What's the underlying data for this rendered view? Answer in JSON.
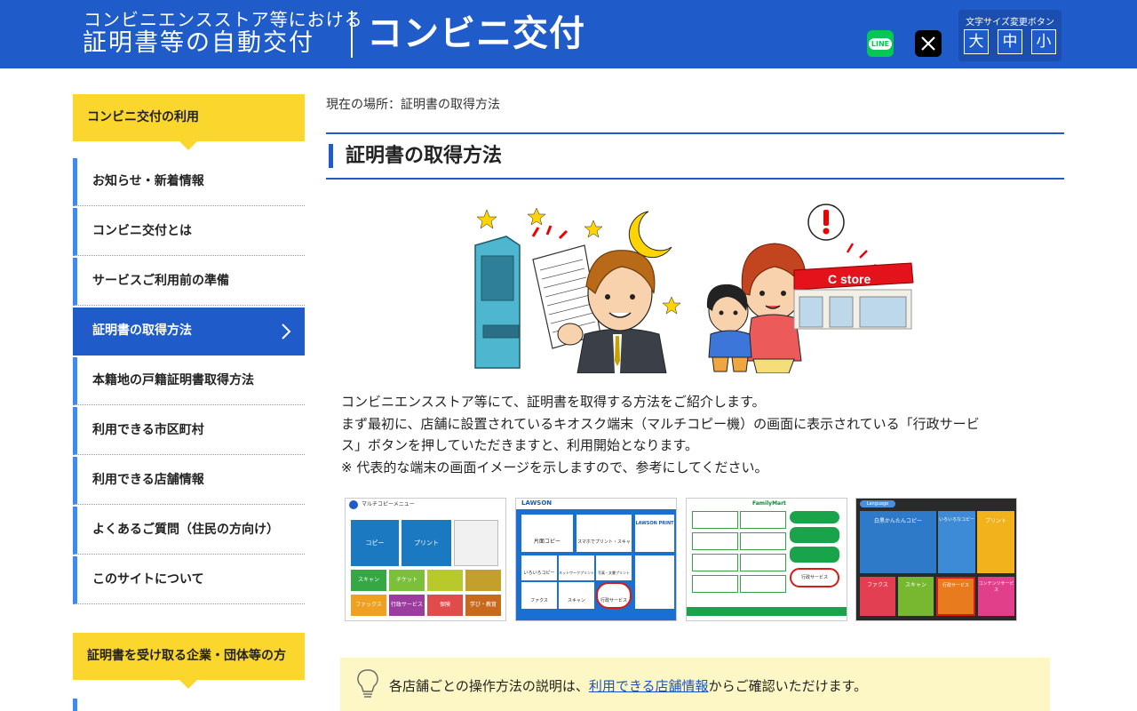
{
  "header": {
    "subtitle": "コンビニエンスストア等における",
    "main_title": "証明書等の自動交付",
    "brand": "コンビニ交付",
    "social": {
      "line_label": "LINE",
      "x_label": "X"
    },
    "font_size": {
      "label": "文字サイズ変更ボタン",
      "large": "大",
      "medium": "中",
      "small": "小"
    }
  },
  "sidebar": {
    "section1_title": "コンビニ交付の利用",
    "items": [
      {
        "label": "お知らせ・新着情報"
      },
      {
        "label": "コンビニ交付とは"
      },
      {
        "label": "サービスご利用前の準備"
      },
      {
        "label": "証明書の取得方法",
        "active": true
      },
      {
        "label": "本籍地の戸籍証明書取得方法"
      },
      {
        "label": "利用できる市区町村"
      },
      {
        "label": "利用できる店舗情報"
      },
      {
        "label": "よくあるご質問（住民の方向け）"
      },
      {
        "label": "このサイトについて"
      }
    ],
    "section2_title": "証明書を受け取る企業・団体等の方"
  },
  "main": {
    "breadcrumb": "現在の場所：証明書の取得方法",
    "title": "証明書の取得方法",
    "illustration_text": "C store",
    "intro_line1": "コンビニエンスストア等にて、証明書を取得する方法をご紹介します。",
    "intro_line2": "まず最初に、店舗に設置されているキオスク端末（マルチコピー機）の画面に表示されている「行政サービ",
    "intro_line3": "ス」ボタンを押していただきますと、利用開始となります。",
    "intro_line4": "※ 代表的な端末の画面イメージを示しますので、参考にしてください。",
    "thumbnails": [
      {
        "caption": "マルチコピーメニュー",
        "btn1": "コピー",
        "btn2": "プリント",
        "btn3": "スキャン",
        "btn4": "チケット",
        "btn5": "ファックス",
        "btn6": "行政サービス",
        "btn7": "保険",
        "btn8": "学び・教育"
      },
      {
        "caption": "LAWSON",
        "btn1": "片面コピー",
        "btn2": "スマホでプリント・スキャン",
        "btn3": "LAWSON PRINT",
        "btn4": "いろいろコピー",
        "btn5": "ネットワークプリント",
        "btn6": "写真・文書プリント",
        "btn7": "ファクス",
        "btn8": "スキャン",
        "btn9": "行政サービス"
      },
      {
        "caption": "FamilyMart",
        "btn1": "行政サービス"
      },
      {
        "caption": "Language",
        "btn1": "白黒かんたんコピー",
        "btn2": "いろいろなコピー",
        "btn3": "プリント",
        "btn4": "ファクス",
        "btn5": "スキャン",
        "btn6": "行政サービス",
        "btn7": "コンテンツサービス"
      }
    ],
    "info_prefix": "各店舗ごとの操作方法の説明は、",
    "info_link": "利用できる店舗情報",
    "info_suffix": "からご確認いただけます。"
  }
}
